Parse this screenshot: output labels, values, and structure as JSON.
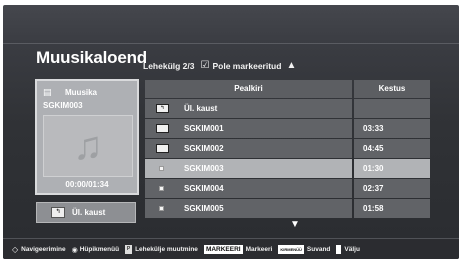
{
  "header": {
    "title": "Muusikaloend",
    "page_info": "Lehekülg 2/3",
    "checkbox_symbol": "☑",
    "no_marked": "Pole markeeritud",
    "up_arrow": "▲"
  },
  "preview": {
    "category": "Muusika",
    "file": "SGKIM003",
    "time": "00:00/01:34",
    "note_symbol": "♫"
  },
  "up_folder_button": "Ül. kaust",
  "list": {
    "col_name": "Pealkiri",
    "col_duration": "Kestus",
    "rows": [
      {
        "type": "upfolder",
        "name": "Ül. kaust",
        "duration": ""
      },
      {
        "type": "folder",
        "name": "SGKIM001",
        "duration": "03:33"
      },
      {
        "type": "folder",
        "name": "SGKIM002",
        "duration": "04:45"
      },
      {
        "type": "file",
        "name": "SGKIM003",
        "duration": "01:30",
        "selected": true
      },
      {
        "type": "file",
        "name": "SGKIM004",
        "duration": "02:37"
      },
      {
        "type": "file",
        "name": "SGKIM005",
        "duration": "01:58"
      }
    ],
    "down_arrow": "▼"
  },
  "footer": {
    "navigate": "Navigeerimine",
    "popup_menu": "Hüpikmenüü",
    "page_change": "Lehekülje muutmine",
    "mark_key": "MARKEERI",
    "mark": "Markeeri",
    "red_key": "KIRMENÜÜ",
    "options": "Suvand",
    "exit": "Välju"
  }
}
